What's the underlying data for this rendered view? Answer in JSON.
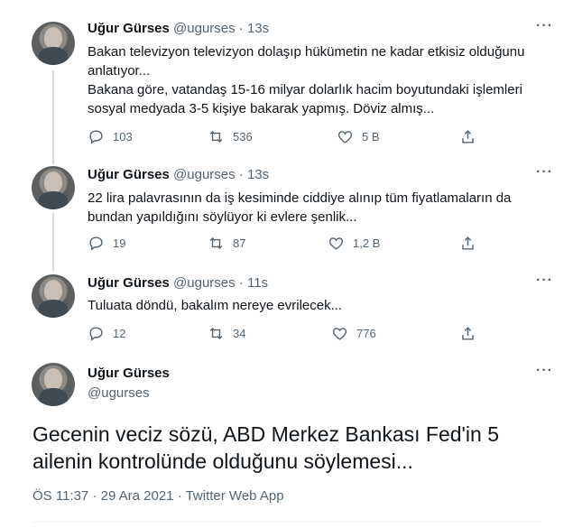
{
  "tweets": [
    {
      "name": "Uğur Gürses",
      "handle": "@ugurses",
      "time": "13s",
      "text": "Bakan televizyon televizyon dolaşıp hükümetin ne kadar etkisiz olduğunu anlatıyor...\nBakana göre, vatandaş 15-16 milyar dolarlık hacim boyutundaki işlemleri sosyal medyada 3-5 kişiye bakarak yapmış. Döviz almış...",
      "replies": "103",
      "retweets": "536",
      "likes": "5 B"
    },
    {
      "name": "Uğur Gürses",
      "handle": "@ugurses",
      "time": "13s",
      "text": "22 lira palavrasının da iş kesiminde ciddiye alınıp tüm fiyatlamaların da bundan yapıldığını söylüyor ki evlere şenlik...",
      "replies": "19",
      "retweets": "87",
      "likes": "1,2 B"
    },
    {
      "name": "Uğur Gürses",
      "handle": "@ugurses",
      "time": "11s",
      "text": "Tuluata döndü, bakalım nereye evrilecek...",
      "replies": "12",
      "retweets": "34",
      "likes": "776"
    }
  ],
  "main_tweet": {
    "name": "Uğur Gürses",
    "handle": "@ugurses",
    "text": "Gecenin veciz sözü, ABD Merkez Bankası Fed'in 5 ailenin kontrolünde olduğunu söylemesi...",
    "time": "ÖS 11:37",
    "date": "29 Ara 2021",
    "source": "Twitter Web App"
  },
  "icons": {
    "reply": "reply-icon",
    "retweet": "retweet-icon",
    "like": "heart-icon",
    "share": "share-icon",
    "more": "more-icon"
  },
  "colors": {
    "text": "#0f1419",
    "muted": "#536471",
    "thread_line": "#cfd9de"
  }
}
